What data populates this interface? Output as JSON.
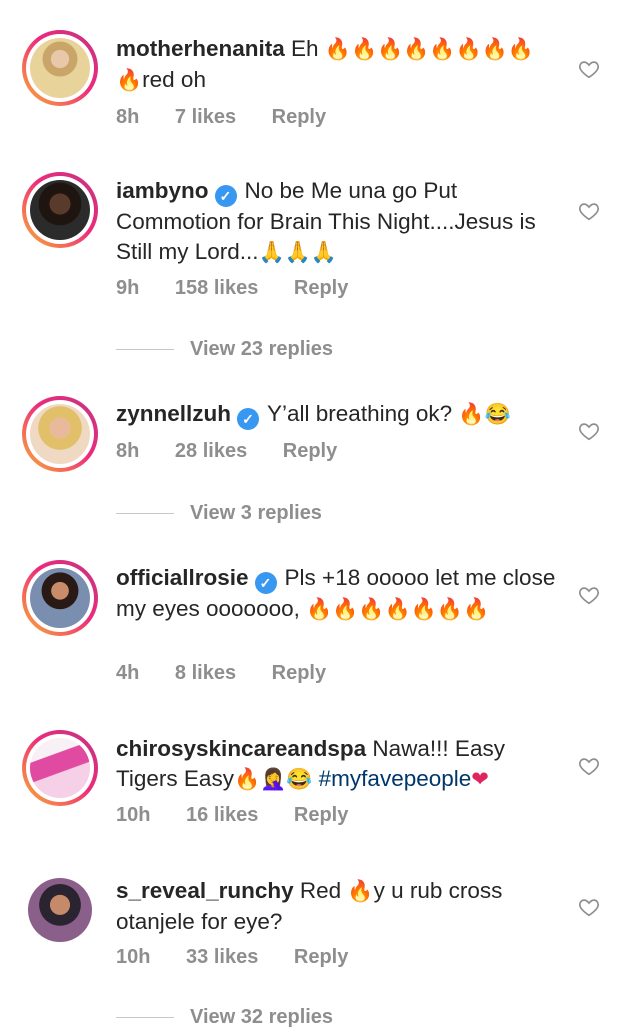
{
  "comments": [
    {
      "username": "motherhenanita",
      "verified": false,
      "text_before": "Eh ",
      "emoji": "🔥🔥🔥🔥🔥🔥🔥🔥🔥",
      "text_after": "red oh",
      "time": "8h",
      "likes": "7 likes",
      "reply": "Reply"
    },
    {
      "username": "iambyno",
      "verified": true,
      "text_before": "No be Me una go Put Commotion for Brain This Night....Jesus is Still my Lord...",
      "emoji": "🙏🙏🙏",
      "text_after": "",
      "time": "9h",
      "likes": "158 likes",
      "reply": "Reply",
      "view_replies": "View 23 replies"
    },
    {
      "username": "zynnellzuh",
      "verified": true,
      "text_before": "Y’all breathing ok? ",
      "emoji": "🔥😂",
      "text_after": "",
      "time": "8h",
      "likes": "28 likes",
      "reply": "Reply",
      "view_replies": "View 3 replies"
    },
    {
      "username": "officiallrosie",
      "verified": true,
      "text_before": "Pls +18 ooooo let me close my eyes ooooooo, ",
      "emoji": "🔥🔥🔥🔥🔥🔥🔥",
      "text_after": "",
      "time": "4h",
      "likes": "8 likes",
      "reply": "Reply"
    },
    {
      "username": "chirosyskincareandspa",
      "verified": false,
      "text_before": "Nawa!!! Easy Tigers Easy",
      "emoji": "🔥🤦‍♀️😂",
      "hashtag": "#myfavepeople",
      "heart": "❤",
      "text_after": "",
      "time": "10h",
      "likes": "16 likes",
      "reply": "Reply"
    },
    {
      "username": "s_reveal_runchy",
      "verified": false,
      "text_before": "Red ",
      "emoji": "🔥",
      "text_after": "y u rub cross otanjele for eye?",
      "time": "10h",
      "likes": "33 likes",
      "reply": "Reply",
      "view_replies": "View 32 replies"
    }
  ],
  "verified_glyph": "✓",
  "icons": {
    "like": "heart-outline-icon",
    "verified": "verified-badge-icon"
  },
  "colors": {
    "accent": "#3897f0",
    "muted": "#8e8e8e",
    "hashtag": "#00376b",
    "heart": "#e0245e"
  }
}
